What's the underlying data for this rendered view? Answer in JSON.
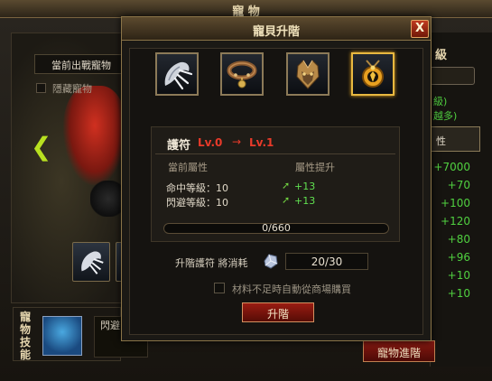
{
  "background_window": {
    "title": "寵 物",
    "pet_select": "當前出戰寵物",
    "hide_pet_label": "隱藏寵物",
    "skills_label": "寵物技能",
    "skill_text": "閃避",
    "right_heading": "級",
    "right_note_1": "級)",
    "right_note_2": "越多)",
    "right_tab": "性",
    "stat_values": [
      "+7000",
      "+70",
      "+100",
      "+120",
      "+80",
      "+96",
      "+10",
      "+10"
    ],
    "evolve_button": "寵物進階",
    "left_arrow_icon": "chevron-left-icon"
  },
  "modal": {
    "title": "寵貝升階",
    "close_label": "X",
    "equipment_slots": [
      {
        "name": "claw",
        "icon": "claw-icon"
      },
      {
        "name": "collar",
        "icon": "collar-icon"
      },
      {
        "name": "helmet",
        "icon": "helmet-icon"
      },
      {
        "name": "amulet",
        "icon": "amulet-icon",
        "selected": true
      }
    ],
    "item_name": "護符",
    "level_from": "Lv.0",
    "level_arrow": "→",
    "level_to": "Lv.1",
    "header_current": "當前屬性",
    "header_boost": "屬性提升",
    "stats": [
      {
        "name": "命中等級：10",
        "gain": "+13"
      },
      {
        "name": "閃避等級：10",
        "gain": "+13"
      }
    ],
    "progress": {
      "text": "0/660",
      "fraction": 0.0
    },
    "cost_label": "升階護符 將消耗",
    "cost_value": "20/30",
    "autobuy_label": "材料不足時自動從商場購買",
    "upgrade_button": "升階",
    "colors": {
      "accent_red": "#e83a2a",
      "gain_green": "#60e050",
      "frame_gold": "#8a7448"
    }
  }
}
